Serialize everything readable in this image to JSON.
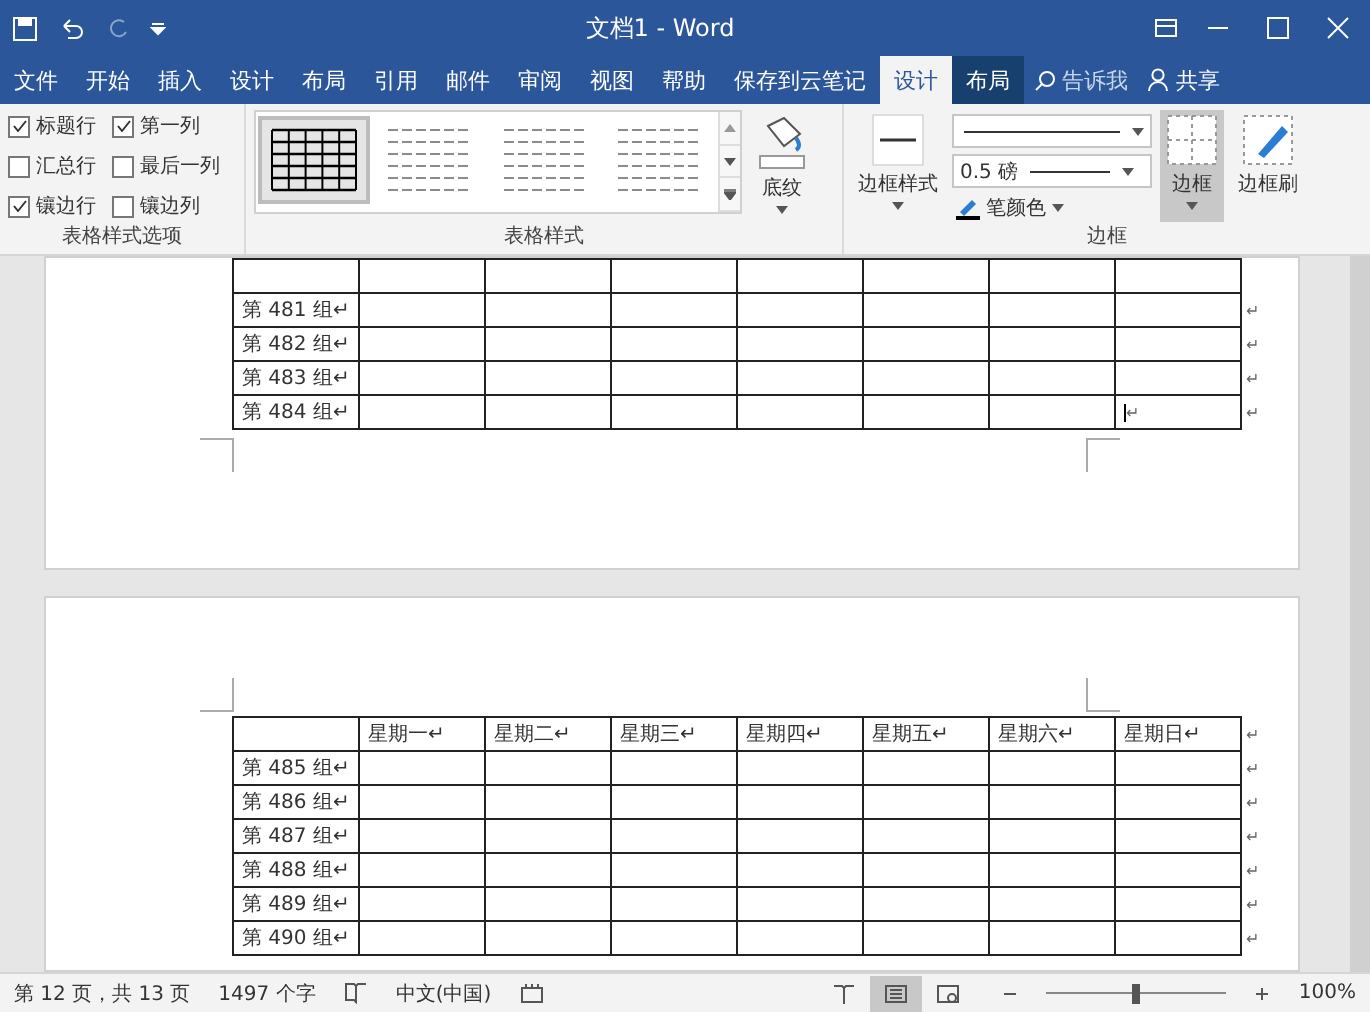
{
  "window": {
    "title": "文档1  -  Word"
  },
  "tabs": [
    {
      "label": "文件",
      "selected": false,
      "contextual": false
    },
    {
      "label": "开始",
      "selected": false,
      "contextual": false
    },
    {
      "label": "插入",
      "selected": false,
      "contextual": false
    },
    {
      "label": "设计",
      "selected": false,
      "contextual": false
    },
    {
      "label": "布局",
      "selected": false,
      "contextual": false
    },
    {
      "label": "引用",
      "selected": false,
      "contextual": false
    },
    {
      "label": "邮件",
      "selected": false,
      "contextual": false
    },
    {
      "label": "审阅",
      "selected": false,
      "contextual": false
    },
    {
      "label": "视图",
      "selected": false,
      "contextual": false
    },
    {
      "label": "帮助",
      "selected": false,
      "contextual": false
    },
    {
      "label": "保存到云笔记",
      "selected": false,
      "contextual": false
    },
    {
      "label": "设计",
      "selected": true,
      "contextual": true
    },
    {
      "label": "布局",
      "selected": false,
      "contextual": true
    }
  ],
  "tell_me": "告诉我",
  "share": "共享",
  "style_options": {
    "label": "表格样式选项",
    "checkboxes": [
      {
        "label": "标题行",
        "checked": true
      },
      {
        "label": "第一列",
        "checked": true
      },
      {
        "label": "汇总行",
        "checked": false
      },
      {
        "label": "最后一列",
        "checked": false
      },
      {
        "label": "镶边行",
        "checked": true
      },
      {
        "label": "镶边列",
        "checked": false
      }
    ]
  },
  "table_styles": {
    "label": "表格样式",
    "styles": [
      {
        "selected": true
      },
      {
        "selected": false
      },
      {
        "selected": false
      },
      {
        "selected": false
      }
    ],
    "shading": "底纹"
  },
  "borders": {
    "label": "边框",
    "border_styles": "边框样式",
    "weight": "0.5 磅",
    "pen_color": "笔颜色",
    "border": {
      "label": "边框",
      "pressed": true
    },
    "painter": "边框刷"
  },
  "page1_rows": [
    {
      "label": "第 481 组↵",
      "end": "↵",
      "cursor": false
    },
    {
      "label": "第 482 组↵",
      "end": "↵",
      "cursor": false
    },
    {
      "label": "第 483 组↵",
      "end": "↵",
      "cursor": false
    },
    {
      "label": "第 484 组↵",
      "end": "↵",
      "cursor": true,
      "cursor_mark": "↵"
    }
  ],
  "page2_header": {
    "cells": [
      "星期一↵",
      "星期二↵",
      "星期三↵",
      "星期四↵",
      "星期五↵",
      "星期六↵",
      "星期日↵"
    ],
    "end": "↵"
  },
  "page2_rows": [
    {
      "label": "第 485 组↵",
      "end": "↵"
    },
    {
      "label": "第 486 组↵",
      "end": "↵"
    },
    {
      "label": "第 487 组↵",
      "end": "↵"
    },
    {
      "label": "第 488 组↵",
      "end": "↵"
    },
    {
      "label": "第 489 组↵",
      "end": "↵"
    },
    {
      "label": "第 490 组↵",
      "end": "↵"
    }
  ],
  "status_bar": {
    "page": "第 12 页，共 13 页",
    "words": "1497 个字",
    "language": "中文(中国)",
    "zoom": "100%",
    "zoom_slider": {
      "level": 0.5
    }
  }
}
